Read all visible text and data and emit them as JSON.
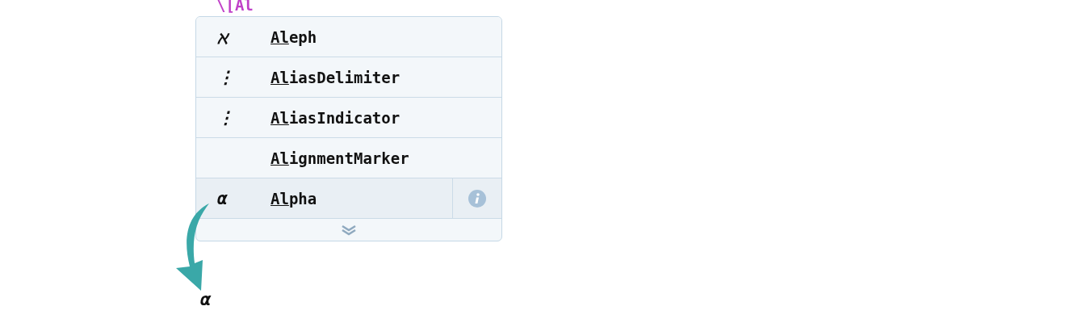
{
  "input": {
    "value": "\\[Al"
  },
  "completions": [
    {
      "symbol": "ℵ",
      "match": "Al",
      "rest": "eph",
      "selected": false
    },
    {
      "symbol": "⋮",
      "match": "Al",
      "rest": "iasDelimiter",
      "selected": false
    },
    {
      "symbol": "⋮",
      "match": "Al",
      "rest": "iasIndicator",
      "selected": false
    },
    {
      "match": "Al",
      "rest": "ignmentMarker",
      "selected": false
    },
    {
      "symbol": "α",
      "match": "Al",
      "rest": "pha",
      "selected": true
    }
  ],
  "result": "α"
}
